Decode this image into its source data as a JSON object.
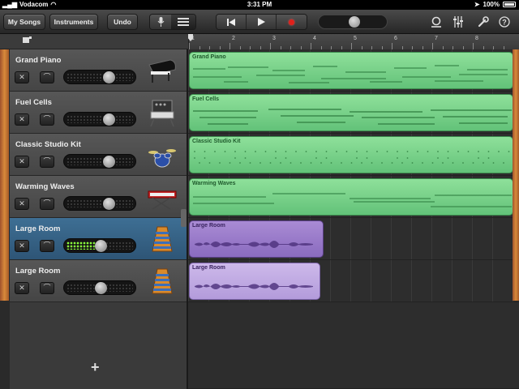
{
  "status_bar": {
    "carrier": "Vodacom",
    "time": "3:31 PM",
    "battery": "100%"
  },
  "toolbar": {
    "my_songs_label": "My Songs",
    "instruments_label": "Instruments",
    "undo_label": "Undo",
    "view_toggle": [
      "microphone-icon",
      "tracks-view-icon"
    ],
    "transport": [
      "rewind-icon",
      "play-icon",
      "record-icon"
    ],
    "master_volume": 0.5,
    "right_icons": [
      "loop-icon",
      "mixer-icon",
      "wrench-icon",
      "help-icon"
    ]
  },
  "ruler": {
    "bars": [
      "1",
      "2",
      "3",
      "4",
      "5",
      "6",
      "7",
      "8"
    ]
  },
  "tracks": [
    {
      "name": "Grand Piano",
      "instrument_icon": "grand-piano-icon",
      "volume": 0.65,
      "selected": false,
      "region": {
        "label": "Grand Piano",
        "color": "#7fd58e"
      }
    },
    {
      "name": "Fuel Cells",
      "instrument_icon": "synth-icon",
      "volume": 0.65,
      "selected": false,
      "region": {
        "label": "Fuel Cells",
        "color": "#7fd58e"
      }
    },
    {
      "name": "Classic Studio Kit",
      "instrument_icon": "drum-kit-icon",
      "volume": 0.65,
      "selected": false,
      "region": {
        "label": "Classic Studio Kit",
        "color": "#7fd58e"
      }
    },
    {
      "name": "Warming Waves",
      "instrument_icon": "keyboard-icon",
      "volume": 0.65,
      "selected": false,
      "region": {
        "label": "Warming Waves",
        "color": "#7fd58e"
      }
    },
    {
      "name": "Large Room",
      "instrument_icon": "smart-strings-icon",
      "volume": 0.5,
      "selected": true,
      "region": {
        "label": "Large Room",
        "color": "#9b7dcb"
      }
    },
    {
      "name": "Large Room",
      "instrument_icon": "smart-strings-icon",
      "volume": 0.5,
      "selected": false,
      "region": {
        "label": "Large Room",
        "color": "#c1acdf"
      }
    }
  ],
  "colors": {
    "accent_green": "#7fd58e",
    "accent_purple": "#9b7dcb",
    "selected_track": "#3e6f94",
    "record": "#e0211b"
  },
  "add_track_label": "+"
}
